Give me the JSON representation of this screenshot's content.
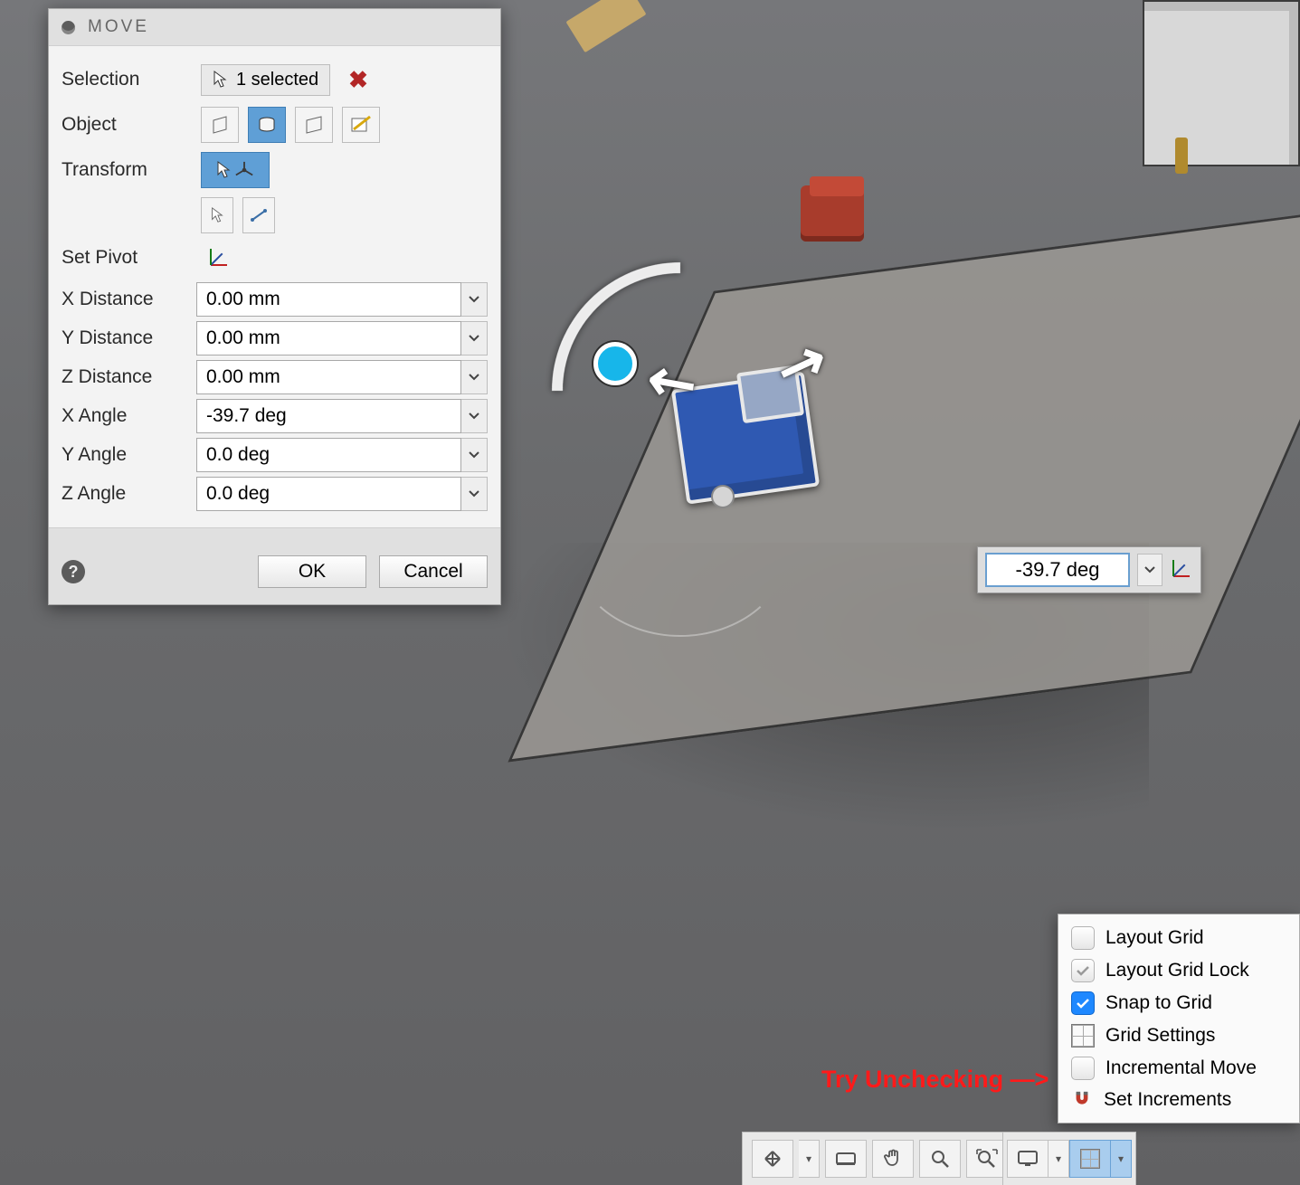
{
  "panel": {
    "title": "MOVE",
    "labels": {
      "selection": "Selection",
      "object": "Object",
      "transform": "Transform",
      "set_pivot": "Set Pivot"
    },
    "selection_text": "1 selected",
    "fields": {
      "x_dist_label": "X Distance",
      "y_dist_label": "Y Distance",
      "z_dist_label": "Z Distance",
      "x_ang_label": "X Angle",
      "y_ang_label": "Y Angle",
      "z_ang_label": "Z Angle",
      "x_dist": "0.00 mm",
      "y_dist": "0.00 mm",
      "z_dist": "0.00 mm",
      "x_ang": "-39.7 deg",
      "y_ang": "0.0 deg",
      "z_ang": "0.0 deg"
    },
    "buttons": {
      "ok": "OK",
      "cancel": "Cancel"
    }
  },
  "viewport_input": {
    "value": "-39.7 deg"
  },
  "snap_popup": {
    "items": [
      {
        "label": "Layout Grid",
        "kind": "checkbox",
        "checked": false
      },
      {
        "label": "Layout Grid Lock",
        "kind": "checkbox",
        "checked": "mixed"
      },
      {
        "label": "Snap to Grid",
        "kind": "checkbox",
        "checked": true
      },
      {
        "label": "Grid Settings",
        "kind": "action-grid"
      },
      {
        "label": "Incremental Move",
        "kind": "checkbox",
        "checked": false
      },
      {
        "label": "Set Increments",
        "kind": "action-magnet"
      }
    ]
  },
  "annotation": "Try Unchecking —>",
  "nav_icons": {
    "orbit": "orbit-icon",
    "look": "look-icon",
    "pan": "pan-icon",
    "zoom": "zoom-icon",
    "fit": "fit-icon",
    "display": "display-style-icon",
    "grid": "grid-snap-icon"
  }
}
